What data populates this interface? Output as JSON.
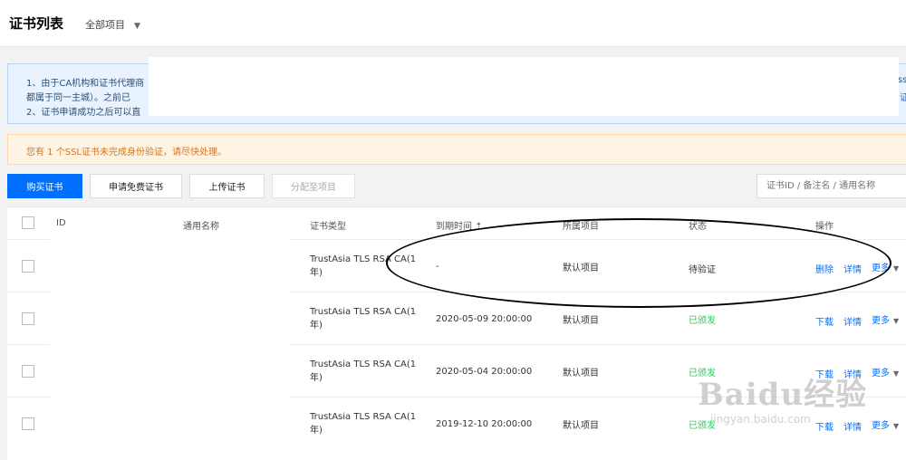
{
  "header": {
    "title": "证书列表",
    "project_select": "全部项目"
  },
  "notice": {
    "line1": "1、由于CA机构和证书代理商",
    "line2": "都属于同一主城）。之前已",
    "line3": "2、证书申请成功之后可以直",
    "line1_right": "ss",
    "line2_right": "证"
  },
  "warning": {
    "text": "您有  1  个SSL证书未完成身份验证，请尽快处理。"
  },
  "toolbar": {
    "buy": "购买证书",
    "apply_free": "申请免费证书",
    "upload": "上传证书",
    "assign": "分配至项目",
    "search_placeholder": "证书ID / 备注名 / 通用名称"
  },
  "table": {
    "headers": {
      "id": "ID",
      "common_name": "通用名称",
      "cert_type": "证书类型",
      "expire": "到期时间",
      "project": "所属项目",
      "status": "状态",
      "actions": "操作"
    },
    "rows": [
      {
        "cert_type": "TrustAsia TLS RSA CA(1年)",
        "expire": "-",
        "project": "默认项目",
        "status": "待验证",
        "action1": "删除",
        "action2": "详情",
        "action3": "更多"
      },
      {
        "cert_type": "TrustAsia TLS RSA CA(1年)",
        "expire": "2020-05-09 20:00:00",
        "project": "默认项目",
        "status": "已颁发",
        "action1": "下载",
        "action2": "详情",
        "action3": "更多"
      },
      {
        "cert_type": "TrustAsia TLS RSA CA(1年)",
        "expire": "2020-05-04 20:00:00",
        "project": "默认项目",
        "status": "已颁发",
        "action1": "下载",
        "action2": "详情",
        "action3": "更多"
      },
      {
        "cert_type": "TrustAsia TLS RSA CA(1年)",
        "expire": "2019-12-10 20:00:00",
        "project": "默认项目",
        "status": "已颁发",
        "action1": "下载",
        "action2": "详情",
        "action3": "更多"
      }
    ]
  },
  "watermark": {
    "brand": "Baidu经验",
    "url": "jingyan.baidu.com"
  },
  "colors": {
    "primary": "#006eff",
    "issued": "#29cc5f",
    "warning_text": "#d4751c"
  }
}
